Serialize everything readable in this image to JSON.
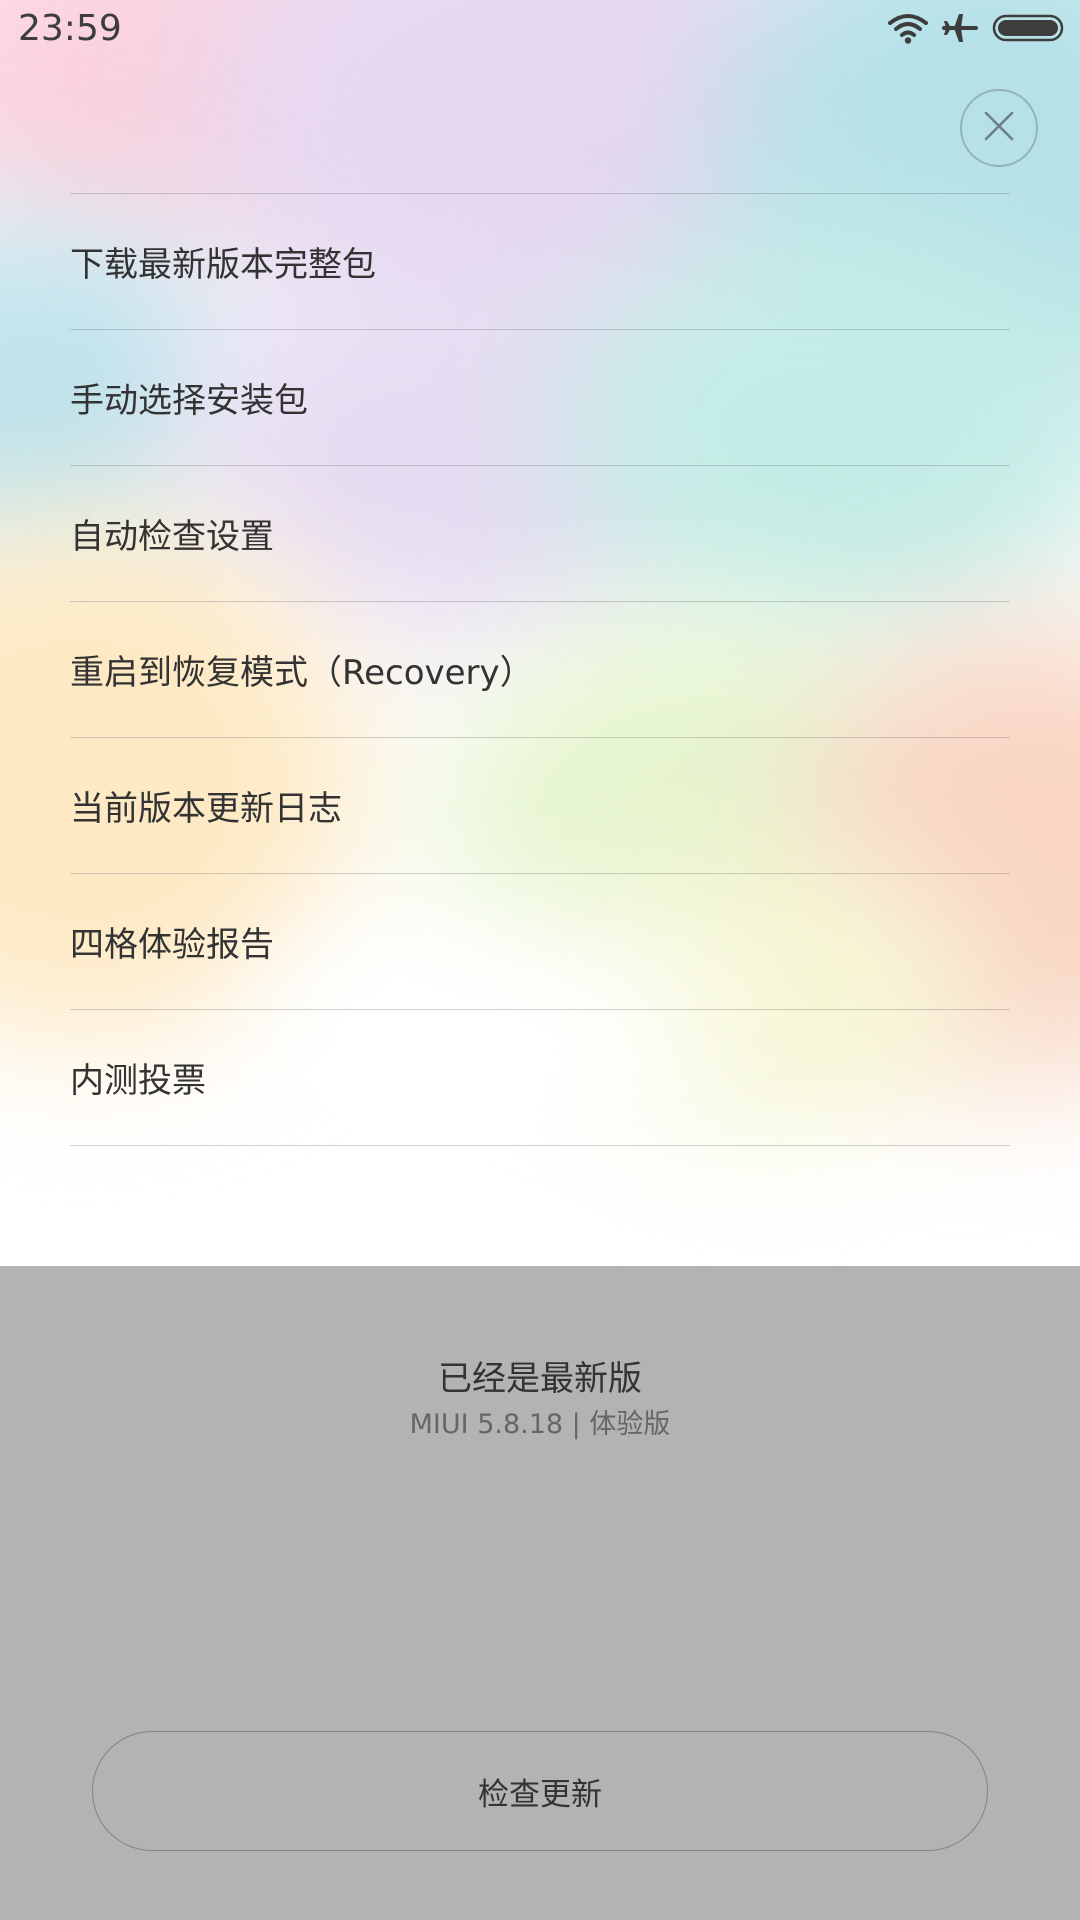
{
  "status_bar": {
    "time": "23:59",
    "icons": [
      "wifi-icon",
      "airplane-mode-icon",
      "battery-icon"
    ]
  },
  "close_button": {
    "icon": "close-icon"
  },
  "menu": {
    "items": [
      {
        "label": "下载最新版本完整包"
      },
      {
        "label": "手动选择安装包"
      },
      {
        "label": "自动检查设置"
      },
      {
        "label": "重启到恢复模式（Recovery）"
      },
      {
        "label": "当前版本更新日志"
      },
      {
        "label": "四格体验报告"
      },
      {
        "label": "内测投票"
      }
    ]
  },
  "update_status": {
    "title": "已经是最新版",
    "version": "MIUI 5.8.18 | 体验版"
  },
  "actions": {
    "check_update_label": "检查更新"
  },
  "colors": {
    "bottom_background": "#b3b3b3",
    "text_primary": "#333333",
    "text_secondary": "#666666"
  }
}
